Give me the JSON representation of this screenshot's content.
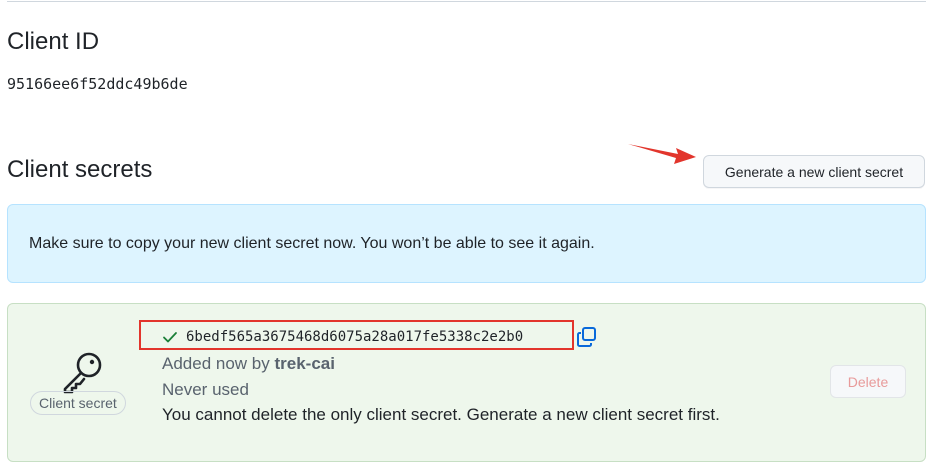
{
  "client_id": {
    "heading": "Client ID",
    "value": "95166ee6f52ddc49b6de"
  },
  "client_secrets": {
    "heading": "Client secrets",
    "generate_button_label": "Generate a new client secret",
    "flash_message": "Make sure to copy your new client secret now. You won’t be able to see it again.",
    "secret": {
      "badge_label": "Client secret",
      "value": "6bedf565a3675468d6075a28a017fe5338c2e2b0",
      "added_prefix": "Added now by ",
      "added_by": "trek-cai",
      "usage": "Never used",
      "note": "You cannot delete the only client secret. Generate a new client secret first.",
      "delete_label": "Delete"
    }
  },
  "colors": {
    "annotation_red": "#e2352c",
    "flash_background": "#ddf4ff",
    "card_background": "#eef7ec",
    "success_green": "#1a7f37",
    "copy_blue": "#0969da"
  },
  "icons": {
    "key": "key-icon",
    "check": "check-icon",
    "copy": "copy-icon",
    "arrow": "arrow-annotation"
  }
}
